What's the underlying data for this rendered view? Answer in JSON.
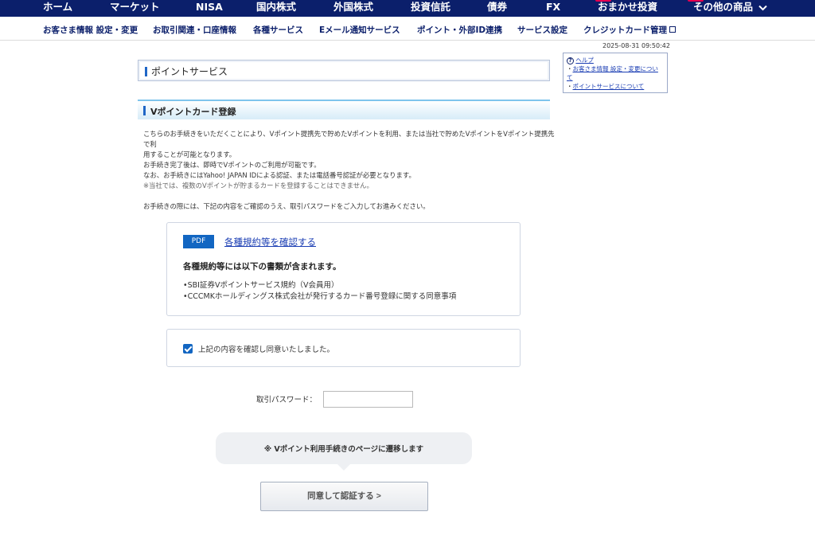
{
  "topnav": {
    "items": [
      "ホーム",
      "マーケット",
      "NISA",
      "国内株式",
      "外国株式",
      "投資信託",
      "債券",
      "FX",
      "おまかせ投資",
      "その他の商品"
    ],
    "dropdown_icon": "chevron-down-icon"
  },
  "subnav": {
    "items": [
      "お客さま情報 設定・変更",
      "お取引関連・口座情報",
      "各種サービス",
      "Eメール通知サービス",
      "ポイント・外部ID連携",
      "サービス設定",
      "クレジットカード管理"
    ]
  },
  "timestamp": "2025-08-31 09:50:42",
  "help": {
    "title": "ヘルプ",
    "links": [
      "お客さま情報 設定・変更について",
      "ポイントサービスについて"
    ]
  },
  "page": {
    "title": "ポイントサービス",
    "section_title": "Vポイントカード登録",
    "intro_lines": [
      "こちらのお手続きをいただくことにより、Vポイント提携先で貯めたVポイントを利用、または当社で貯めたVポイントをVポイント提携先で利",
      "用することが可能となります。",
      "お手続き完了後は、即時でVポイントのご利用が可能です。",
      "なお、お手続きにはYahoo! JAPAN IDによる認証、または電話番号認証が必要となります。"
    ],
    "intro_note": "※当社では、複数のVポイントが貯まるカードを登録することはできません。",
    "intro_instruction": "お手続きの際には、下記の内容をご確認のうえ、取引パスワードをご入力してお進みください。"
  },
  "terms": {
    "badge": "PDF",
    "link_text": "各種規約等を確認する",
    "heading": "各種規約等には以下の書類が含まれます。",
    "items": [
      "•SBI証券Vポイントサービス規約（V会員用）",
      "•CCCMKホールディングス株式会社が発行するカード番号登録に関する同意事項"
    ]
  },
  "agreement": {
    "label": "上記の内容を確認し同意いたしました。",
    "checked": true
  },
  "password": {
    "label": "取引パスワード：",
    "value": "",
    "placeholder": ""
  },
  "notice": "※ Vポイント利用手続きのページに遷移します",
  "submit_label": "同意して認証する >",
  "colors": {
    "nav_bg": "#0b1f6b",
    "accent_blue": "#1266c2",
    "link_blue": "#1a3db3",
    "new_mark": "#e5004f"
  }
}
